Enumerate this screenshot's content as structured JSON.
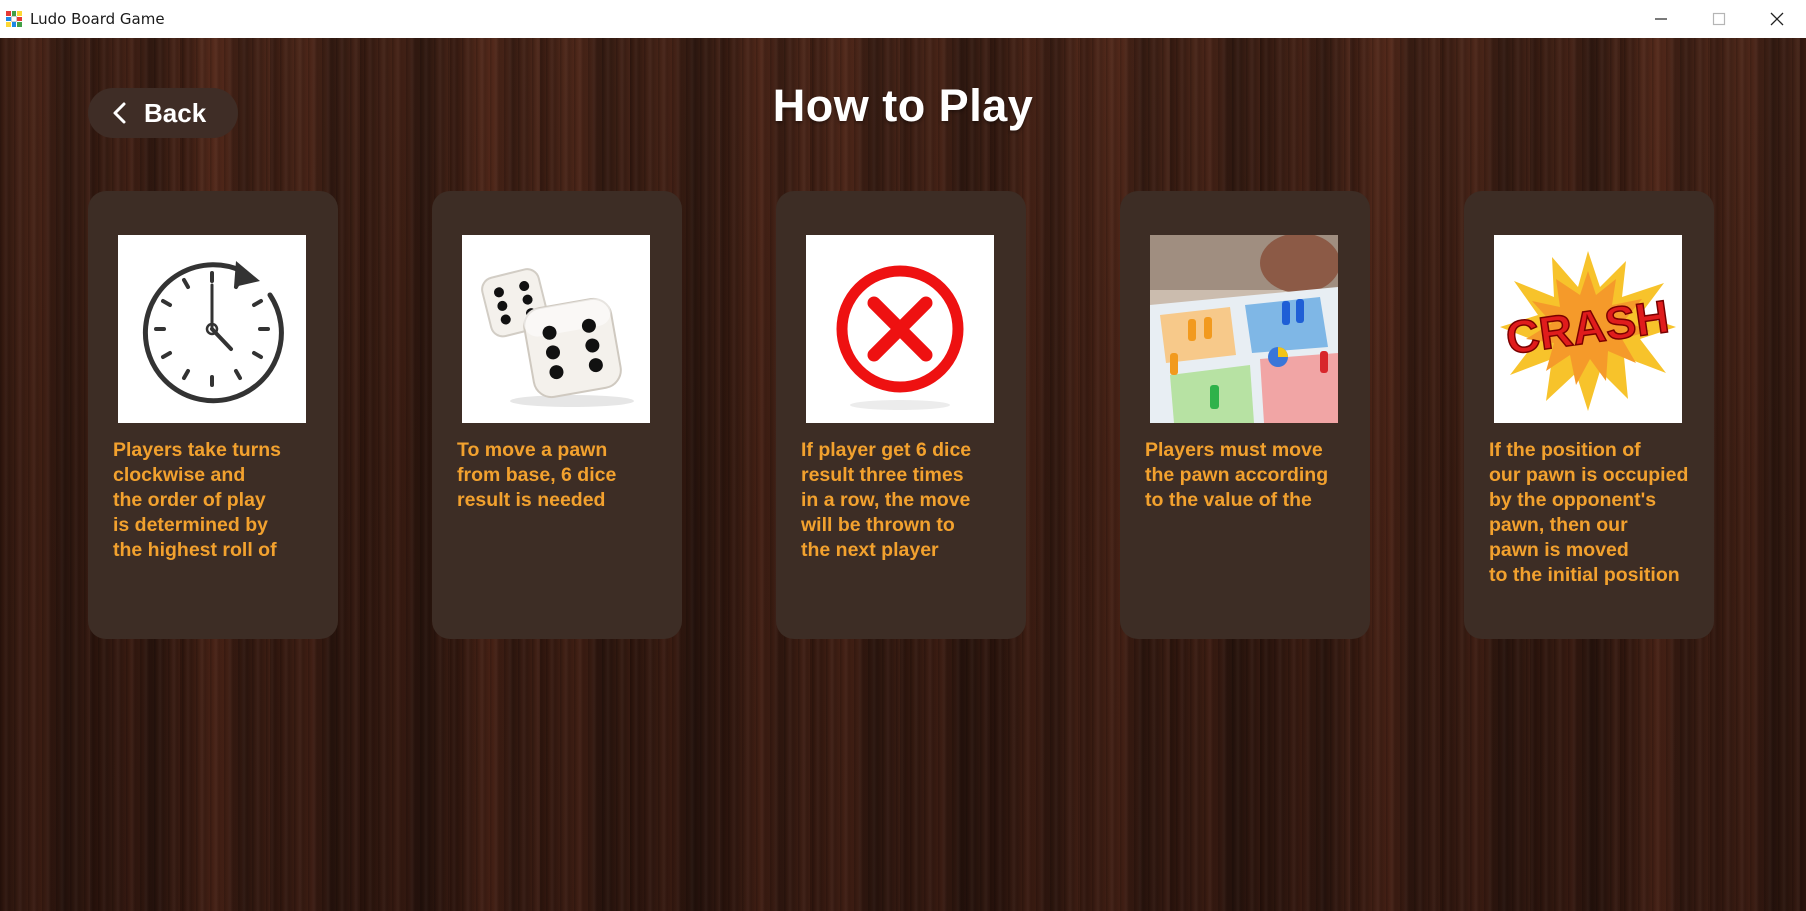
{
  "window": {
    "title": "Ludo Board Game",
    "controls": {
      "minimize": "—",
      "maximize": "☐",
      "close": "✕"
    }
  },
  "header": {
    "back_label": "Back",
    "title": "How to Play"
  },
  "cards": [
    {
      "text": "Players take turns\nclockwise and\nthe order of play\nis determined by\nthe highest roll of",
      "image": "clock-rotate-icon"
    },
    {
      "text": "To move a pawn\nfrom base, 6 dice\nresult is needed",
      "image": "dice-icon"
    },
    {
      "text": "If player get 6 dice\nresult three times\nin a row, the move\nwill be thrown to\nthe next player",
      "image": "red-x-icon"
    },
    {
      "text": "Players must move\nthe pawn according\nto the value of the",
      "image": "ludo-board-photo"
    },
    {
      "text": "If the position of\nour pawn is occupied\nby the opponent's\npawn, then our\npawn is moved\nto the initial position",
      "image": "crash-burst-icon",
      "image_text": "CRASH"
    }
  ],
  "colors": {
    "card_bg": "#3d2d25",
    "card_text": "#f2a12e",
    "title_text": "#ffffff",
    "back_button_bg": "#3f2d26"
  }
}
